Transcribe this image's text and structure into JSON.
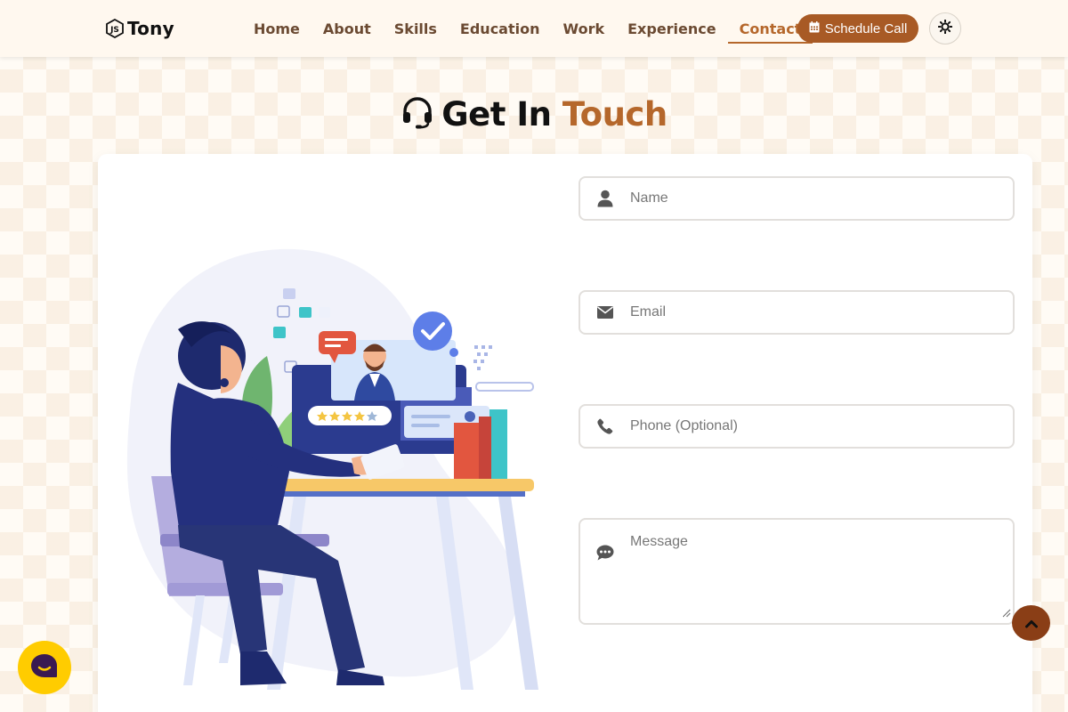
{
  "brand": {
    "name": "Tony",
    "logo_icon": "js-hexagon-icon"
  },
  "nav": {
    "items": [
      {
        "label": "Home",
        "active": false
      },
      {
        "label": "About",
        "active": false
      },
      {
        "label": "Skills",
        "active": false
      },
      {
        "label": "Education",
        "active": false
      },
      {
        "label": "Work",
        "active": false
      },
      {
        "label": "Experience",
        "active": false
      },
      {
        "label": "Contact",
        "active": true
      }
    ],
    "schedule_label": "Schedule Call",
    "schedule_icon": "calendar-icon",
    "theme_icon": "sun-icon"
  },
  "section": {
    "title_main": "Get In",
    "title_accent": "Touch",
    "title_icon": "headset-icon"
  },
  "form": {
    "name_placeholder": "Name",
    "email_placeholder": "Email",
    "phone_placeholder": "Phone (Optional)",
    "message_placeholder": "Message"
  },
  "floating": {
    "scroll_top_icon": "chevron-up-icon",
    "chat_icon": "chat-bubble-icon"
  },
  "colors": {
    "accent": "#b5672b",
    "button": "#a85a25",
    "scroll_top": "#8a3e16",
    "chat": "#ffcc00",
    "nav_text": "#6b4a32"
  }
}
